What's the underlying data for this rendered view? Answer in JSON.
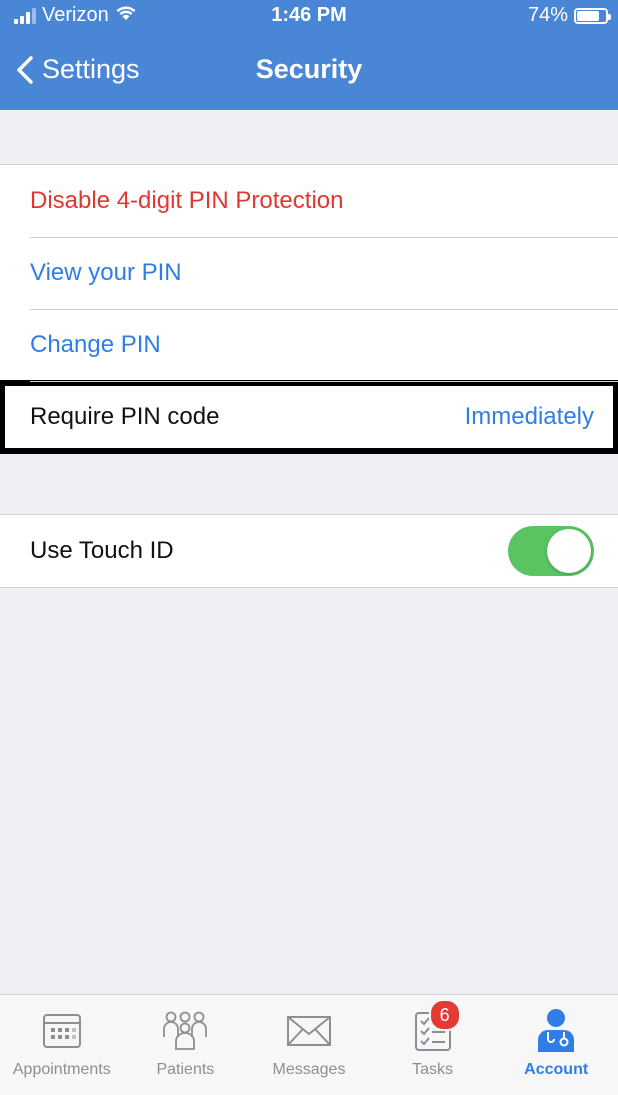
{
  "status_bar": {
    "carrier": "Verizon",
    "time": "1:46 PM",
    "battery": "74%",
    "battery_level": 0.74,
    "signal_icon": "signal-icon",
    "wifi_icon": "wifi-icon",
    "battery_icon": "battery-icon"
  },
  "nav": {
    "back_label": "Settings",
    "title": "Security"
  },
  "pin_section": {
    "items": [
      {
        "label": "Disable 4-digit PIN Protection",
        "style": "destructive"
      },
      {
        "label": "View your PIN",
        "style": "link"
      },
      {
        "label": "Change PIN",
        "style": "link"
      }
    ],
    "require_pin": {
      "label": "Require PIN code",
      "value": "Immediately"
    }
  },
  "touch_section": {
    "label": "Use Touch ID",
    "enabled": true
  },
  "tab_bar": {
    "tabs": [
      {
        "label": "Appointments",
        "icon": "calendar-icon",
        "active": false
      },
      {
        "label": "Patients",
        "icon": "people-icon",
        "active": false
      },
      {
        "label": "Messages",
        "icon": "envelope-icon",
        "active": false
      },
      {
        "label": "Tasks",
        "icon": "checklist-icon",
        "active": false,
        "badge": "6"
      },
      {
        "label": "Account",
        "icon": "doctor-icon",
        "active": true
      }
    ]
  },
  "colors": {
    "header": "#4a86d6",
    "destructive": "#e0382f",
    "link": "#2f7ee6",
    "toggle_on": "#5ac463",
    "badge": "#e53935"
  }
}
